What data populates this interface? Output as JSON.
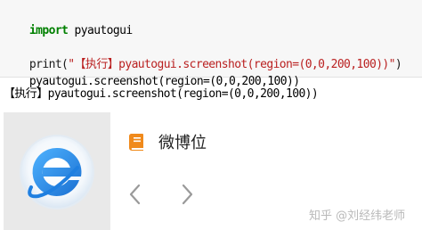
{
  "code": {
    "line1": {
      "keyword": "import",
      "module": " pyautogui"
    },
    "line3": {
      "func": "print(",
      "string": "\"【执行】pyautogui.screenshot(region=(0,0,200,100))\"",
      "close": ")"
    },
    "line4": "pyautogui.screenshot(region=(0,0,200,100))"
  },
  "output": {
    "text": "【执行】pyautogui.screenshot(region=(0,0,200,100))"
  },
  "screenshot": {
    "logo_icon": "ie-e-logo-icon",
    "weibo_icon": "book-icon",
    "weibo_text": "微博位",
    "prev_icon": "chevron-left-icon",
    "next_icon": "chevron-right-icon",
    "watermark": "知乎 @刘经纬老师"
  },
  "colors": {
    "keyword": "#008000",
    "string": "#ba2121",
    "logo_blue": "#2a8ee8",
    "book_orange": "#f08a1c"
  }
}
